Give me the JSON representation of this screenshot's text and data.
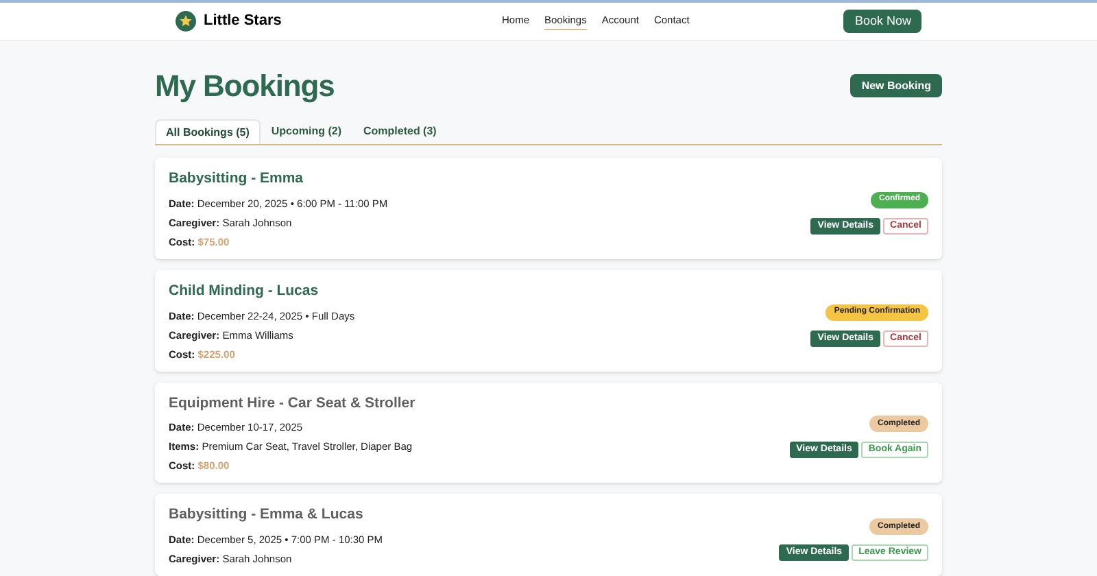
{
  "nav": {
    "brand": "Little Stars",
    "links": [
      {
        "label": "Home",
        "selected": false
      },
      {
        "label": "Bookings",
        "selected": true
      },
      {
        "label": "Account",
        "selected": false
      },
      {
        "label": "Contact",
        "selected": false
      }
    ],
    "cta": "Book Now"
  },
  "page": {
    "title": "My Bookings",
    "action": "New Booking"
  },
  "tabs": [
    {
      "label": "All Bookings (5)",
      "selected": true
    },
    {
      "label": "Upcoming (2)",
      "selected": false
    },
    {
      "label": "Completed (3)",
      "selected": false
    }
  ],
  "bookings": [
    {
      "title": "Babysitting - Emma",
      "past": false,
      "details": [
        {
          "kind": "text",
          "label": "Date:",
          "value": "December 20, 2025 • 6:00 PM - 11:00 PM"
        },
        {
          "kind": "text",
          "label": "Caregiver:",
          "value": "Sarah Johnson"
        },
        {
          "kind": "cost",
          "label": "Cost:",
          "value": "$75.00"
        }
      ],
      "status": {
        "label": "Confirmed",
        "kind": "confirmed"
      },
      "buttons": [
        {
          "label": "View Details",
          "kind": "primary"
        },
        {
          "label": "Cancel",
          "kind": "danger"
        }
      ]
    },
    {
      "title": "Child Minding - Lucas",
      "past": false,
      "details": [
        {
          "kind": "text",
          "label": "Date:",
          "value": "December 22-24, 2025 • Full Days"
        },
        {
          "kind": "text",
          "label": "Caregiver:",
          "value": "Emma Williams"
        },
        {
          "kind": "cost",
          "label": "Cost:",
          "value": "$225.00"
        }
      ],
      "status": {
        "label": "Pending Confirmation",
        "kind": "pending"
      },
      "buttons": [
        {
          "label": "View Details",
          "kind": "primary"
        },
        {
          "label": "Cancel",
          "kind": "danger"
        }
      ]
    },
    {
      "title": "Equipment Hire - Car Seat & Stroller",
      "past": true,
      "details": [
        {
          "kind": "text",
          "label": "Date:",
          "value": "December 10-17, 2025"
        },
        {
          "kind": "text",
          "label": "Items:",
          "value": "Premium Car Seat, Travel Stroller, Diaper Bag"
        },
        {
          "kind": "cost",
          "label": "Cost:",
          "value": "$80.00"
        }
      ],
      "status": {
        "label": "Completed",
        "kind": "completed"
      },
      "buttons": [
        {
          "label": "View Details",
          "kind": "primary"
        },
        {
          "label": "Book Again",
          "kind": "outline"
        }
      ]
    },
    {
      "title": "Babysitting - Emma & Lucas",
      "past": true,
      "details": [
        {
          "kind": "text",
          "label": "Date:",
          "value": "December 5, 2025 • 7:00 PM - 10:30 PM"
        },
        {
          "kind": "text",
          "label": "Caregiver:",
          "value": "Sarah Johnson"
        }
      ],
      "status": {
        "label": "Completed",
        "kind": "completed"
      },
      "buttons": [
        {
          "label": "View Details",
          "kind": "primary"
        },
        {
          "label": "Leave Review",
          "kind": "outline"
        }
      ]
    }
  ]
}
